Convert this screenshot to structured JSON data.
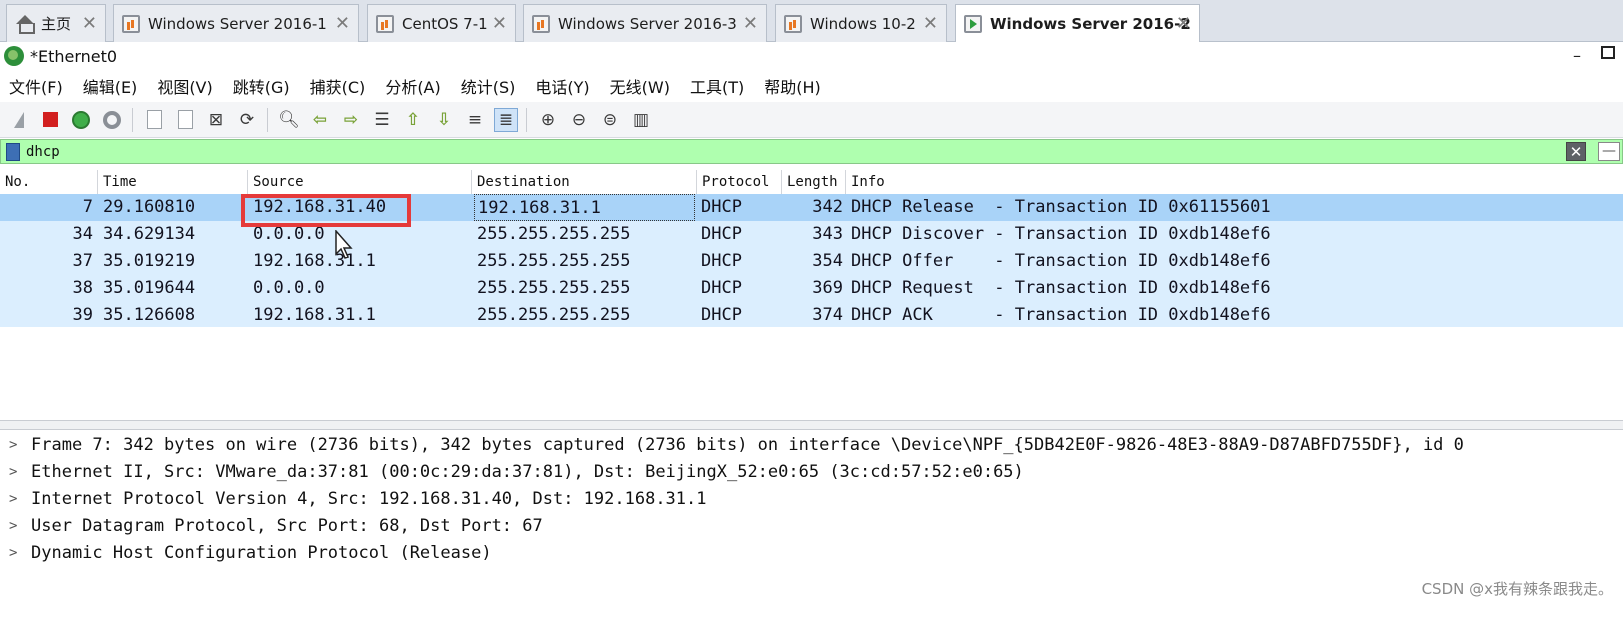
{
  "vm_tabs": [
    {
      "label": "主页"
    },
    {
      "label": "Windows Server 2016-1"
    },
    {
      "label": "CentOS 7-1"
    },
    {
      "label": "Windows Server 2016-3"
    },
    {
      "label": "Windows 10-2"
    },
    {
      "label": "Windows Server 2016-2"
    }
  ],
  "window": {
    "title": "*Ethernet0",
    "minimize": "–"
  },
  "menu": [
    "文件(F)",
    "编辑(E)",
    "视图(V)",
    "跳转(G)",
    "捕获(C)",
    "分析(A)",
    "统计(S)",
    "电话(Y)",
    "无线(W)",
    "工具(T)",
    "帮助(H)"
  ],
  "toolbar_icons": [
    "shark-fin-icon",
    "stop-icon",
    "restart-icon",
    "options-icon",
    "open-icon",
    "save-icon",
    "close-file-icon",
    "reload-icon",
    "find-icon",
    "back-icon",
    "forward-icon",
    "goto-icon",
    "first-icon",
    "last-icon",
    "autoscroll-icon",
    "colorize-icon",
    "zoom-in-icon",
    "zoom-out-icon",
    "zoom-normal-icon",
    "resize-columns-icon"
  ],
  "filter": {
    "value": "dhcp",
    "clear_symbol": "✕",
    "apply_symbol": "—"
  },
  "columns": [
    "No.",
    "Time",
    "Source",
    "Destination",
    "Protocol",
    "Length",
    "Info"
  ],
  "packets": [
    {
      "no": "7",
      "time": "29.160810",
      "source": "192.168.31.40",
      "destination": "192.168.31.1",
      "protocol": "DHCP",
      "length": "342",
      "info": "DHCP Release  - Transaction ID 0x61155601",
      "selected": true
    },
    {
      "no": "34",
      "time": "34.629134",
      "source": "0.0.0.0",
      "destination": "255.255.255.255",
      "protocol": "DHCP",
      "length": "343",
      "info": "DHCP Discover - Transaction ID 0xdb148ef6",
      "selected": false
    },
    {
      "no": "37",
      "time": "35.019219",
      "source": "192.168.31.1",
      "destination": "255.255.255.255",
      "protocol": "DHCP",
      "length": "354",
      "info": "DHCP Offer    - Transaction ID 0xdb148ef6",
      "selected": false
    },
    {
      "no": "38",
      "time": "35.019644",
      "source": "0.0.0.0",
      "destination": "255.255.255.255",
      "protocol": "DHCP",
      "length": "369",
      "info": "DHCP Request  - Transaction ID 0xdb148ef6",
      "selected": false
    },
    {
      "no": "39",
      "time": "35.126608",
      "source": "192.168.31.1",
      "destination": "255.255.255.255",
      "protocol": "DHCP",
      "length": "374",
      "info": "DHCP ACK      - Transaction ID 0xdb148ef6",
      "selected": false
    }
  ],
  "details": [
    "Frame 7: 342 bytes on wire (2736 bits), 342 bytes captured (2736 bits) on interface \\Device\\NPF_{5DB42E0F-9826-48E3-88A9-D87ABFD755DF}, id 0",
    "Ethernet II, Src: VMware_da:37:81 (00:0c:29:da:37:81), Dst: BeijingX_52:e0:65 (3c:cd:57:52:e0:65)",
    "Internet Protocol Version 4, Src: 192.168.31.40, Dst: 192.168.31.1",
    "User Datagram Protocol, Src Port: 68, Dst Port: 67",
    "Dynamic Host Configuration Protocol (Release)"
  ],
  "watermark": "CSDN @x我有辣条跟我走。",
  "colors": {
    "filter_ok": "#afffaf",
    "row_bg": "#dbeefe",
    "row_selected": "#a9d3f8",
    "highlight_box": "#e53a3a"
  }
}
